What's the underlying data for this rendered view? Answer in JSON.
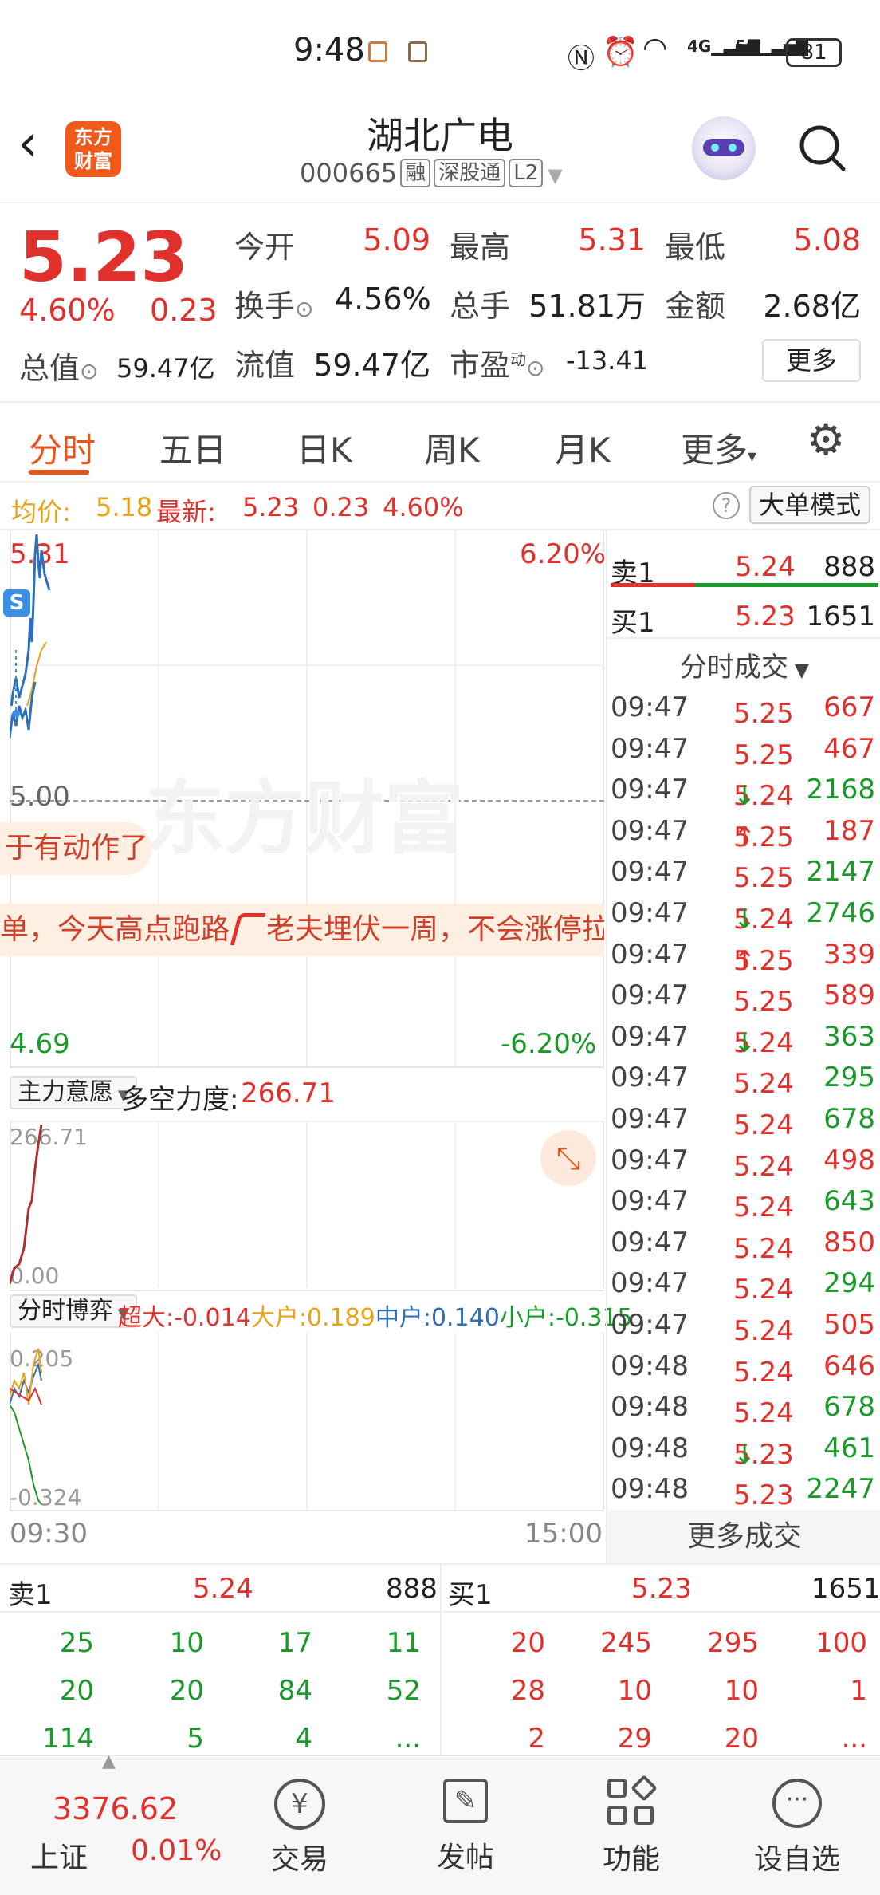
{
  "status_bar": {
    "time": "9:48",
    "battery": "81",
    "net1": "4G",
    "net2": "5G"
  },
  "header": {
    "back_label": "<",
    "logo_line1": "东方",
    "logo_line2": "财富",
    "stock_name": "湖北广电",
    "stock_code": "000665",
    "tags": [
      "融",
      "深股通",
      "L2"
    ]
  },
  "quote": {
    "price": "5.23",
    "change_pct": "4.60%",
    "change": "0.23",
    "open_label": "今开",
    "open": "5.09",
    "high_label": "最高",
    "high": "5.31",
    "low_label": "最低",
    "low": "5.08",
    "turnover_label": "换手",
    "turnover": "4.56%",
    "volume_label": "总手",
    "volume": "51.81万",
    "amount_label": "金额",
    "amount": "2.68亿",
    "mktcap_label": "总值",
    "mktcap": "59.47亿",
    "float_label": "流值",
    "float_cap": "59.47亿",
    "pe_label": "市盈",
    "pe_sup": "动",
    "pe": "-13.41",
    "more_button": "更多"
  },
  "tabs": [
    "分时",
    "五日",
    "日K",
    "周K",
    "月K",
    "更多"
  ],
  "infobar": {
    "avg_label": "均价:",
    "avg": "5.18",
    "latest_label": "最新:",
    "latest": "5.23",
    "change": "0.23",
    "pct": "4.60%",
    "help": "?",
    "mode_button": "大单模式"
  },
  "chart": {
    "top_price": "5.31",
    "top_pct": "6.20%",
    "mid_price": "5.00",
    "bottom_price": "4.69",
    "bottom_pct": "-6.20%",
    "watermark": "东方财富",
    "s_marker": "S",
    "banner1": "于有动作了",
    "banner2": "单，今天高点跑路",
    "banner2b": "老夫埋伏一周，不会涨停拉",
    "ind1_select": "主力意愿",
    "ind1_label": "多空力度:",
    "ind1_value": "266.71",
    "ind1_top": "266.71",
    "ind1_bottom": "0.00",
    "ind2_select": "分时博弈",
    "ind2_items": [
      {
        "label": "超大:",
        "value": "-0.014",
        "color": "#e0312c"
      },
      {
        "label": "大户:",
        "value": "0.189",
        "color": "#e8a317"
      },
      {
        "label": "中户:",
        "value": "0.140",
        "color": "#2f6fb8"
      },
      {
        "label": "小户:",
        "value": "-0.315",
        "color": "#1a9a2a"
      }
    ],
    "ind2_top": "0.205",
    "ind2_bottom": "-0.324",
    "time_start": "09:30",
    "time_end": "15:00"
  },
  "orderbook": {
    "sell1_label": "卖1",
    "sell1_price": "5.24",
    "sell1_vol": "888",
    "buy1_label": "买1",
    "buy1_price": "5.23",
    "buy1_vol": "1651",
    "ticks_title": "分时成交",
    "ticks": [
      {
        "time": "09:47",
        "price": "5.25",
        "arrow": "",
        "vol": "667",
        "vol_color": "red"
      },
      {
        "time": "09:47",
        "price": "5.25",
        "arrow": "",
        "vol": "467",
        "vol_color": "red"
      },
      {
        "time": "09:47",
        "price": "5.24",
        "arrow": "↓",
        "vol": "2168",
        "vol_color": "green"
      },
      {
        "time": "09:47",
        "price": "5.25",
        "arrow": "↑",
        "vol": "187",
        "vol_color": "red"
      },
      {
        "time": "09:47",
        "price": "5.25",
        "arrow": "",
        "vol": "2147",
        "vol_color": "green"
      },
      {
        "time": "09:47",
        "price": "5.24",
        "arrow": "↓",
        "vol": "2746",
        "vol_color": "green"
      },
      {
        "time": "09:47",
        "price": "5.25",
        "arrow": "↑",
        "vol": "339",
        "vol_color": "red"
      },
      {
        "time": "09:47",
        "price": "5.25",
        "arrow": "",
        "vol": "589",
        "vol_color": "red"
      },
      {
        "time": "09:47",
        "price": "5.24",
        "arrow": "↓",
        "vol": "363",
        "vol_color": "green"
      },
      {
        "time": "09:47",
        "price": "5.24",
        "arrow": "",
        "vol": "295",
        "vol_color": "green"
      },
      {
        "time": "09:47",
        "price": "5.24",
        "arrow": "",
        "vol": "678",
        "vol_color": "green"
      },
      {
        "time": "09:47",
        "price": "5.24",
        "arrow": "",
        "vol": "498",
        "vol_color": "red"
      },
      {
        "time": "09:47",
        "price": "5.24",
        "arrow": "",
        "vol": "643",
        "vol_color": "green"
      },
      {
        "time": "09:47",
        "price": "5.24",
        "arrow": "",
        "vol": "850",
        "vol_color": "red"
      },
      {
        "time": "09:47",
        "price": "5.24",
        "arrow": "",
        "vol": "294",
        "vol_color": "green"
      },
      {
        "time": "09:47",
        "price": "5.24",
        "arrow": "",
        "vol": "505",
        "vol_color": "red"
      },
      {
        "time": "09:48",
        "price": "5.24",
        "arrow": "",
        "vol": "646",
        "vol_color": "red"
      },
      {
        "time": "09:48",
        "price": "5.24",
        "arrow": "",
        "vol": "678",
        "vol_color": "green"
      },
      {
        "time": "09:48",
        "price": "5.23",
        "arrow": "↓",
        "vol": "461",
        "vol_color": "green"
      },
      {
        "time": "09:48",
        "price": "5.23",
        "arrow": "",
        "vol": "2247",
        "vol_color": "green"
      }
    ],
    "more_button": "更多成交"
  },
  "bottom_book": {
    "sell_label": "卖1",
    "sell_price": "5.24",
    "sell_vol": "888",
    "buy_label": "买1",
    "buy_price": "5.23",
    "buy_vol": "1651",
    "sell_rows": [
      [
        "25",
        "10",
        "17",
        "11"
      ],
      [
        "20",
        "20",
        "84",
        "52"
      ],
      [
        "114",
        "5",
        "4",
        "..."
      ]
    ],
    "buy_rows": [
      [
        "20",
        "245",
        "295",
        "100"
      ],
      [
        "28",
        "10",
        "10",
        "1"
      ],
      [
        "2",
        "29",
        "20",
        "..."
      ]
    ]
  },
  "nav": {
    "index_value": "3376.62",
    "index_name": "上证",
    "index_pct": "0.01%",
    "items": [
      "交易",
      "发帖",
      "功能",
      "设自选"
    ]
  }
}
